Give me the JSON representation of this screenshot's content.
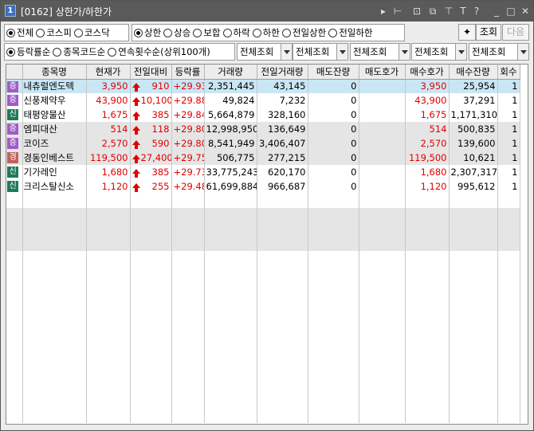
{
  "window": {
    "number": "1",
    "title": "[0162] 상한가/하한가",
    "title_icons": [
      "play-icon",
      "pin-icon",
      "copy-icon",
      "restore-icon",
      "pin2-icon",
      "font-icon",
      "help-icon",
      "minimize-icon",
      "maximize-icon",
      "close-icon"
    ]
  },
  "filters1": {
    "market": [
      {
        "label": "전체",
        "checked": true
      },
      {
        "label": "코스피",
        "checked": false
      },
      {
        "label": "코스닥",
        "checked": false
      }
    ],
    "type": [
      {
        "label": "상한",
        "checked": true
      },
      {
        "label": "상승",
        "checked": false
      },
      {
        "label": "보합",
        "checked": false
      },
      {
        "label": "하락",
        "checked": false
      },
      {
        "label": "하한",
        "checked": false
      },
      {
        "label": "전일상한",
        "checked": false
      },
      {
        "label": "전일하한",
        "checked": false
      }
    ],
    "query_label": "조회",
    "next_label": "다음"
  },
  "filters2": {
    "sort": [
      {
        "label": "등락률순",
        "checked": true
      },
      {
        "label": "종목코드순",
        "checked": false
      },
      {
        "label": "연속횟수순(상위100개)",
        "checked": false
      }
    ],
    "selects": [
      "전체조회",
      "전체조회",
      "전체조회",
      "전체조회",
      "전체조회"
    ]
  },
  "table": {
    "columns": [
      "종목명",
      "현재가",
      "전일대비",
      "등락률",
      "거래량",
      "전일거래량",
      "매도잔량",
      "매도호가",
      "매수호가",
      "매수잔량",
      "회수"
    ],
    "rows": [
      {
        "badge": "증",
        "badge_color": "#a05bc8",
        "name": "내츄럴엔도텍",
        "price": "3,950",
        "change": "910",
        "rate": "+29.93",
        "volume": "2,351,445",
        "prev_volume": "43,145",
        "ask_qty": "0",
        "ask": "",
        "bid": "3,950",
        "bid_qty": "25,954",
        "count": "1",
        "style": "sel"
      },
      {
        "badge": "증",
        "badge_color": "#a05bc8",
        "name": "신풍제약우",
        "price": "43,900",
        "change": "10,100",
        "rate": "+29.88",
        "volume": "49,824",
        "prev_volume": "7,232",
        "ask_qty": "0",
        "ask": "",
        "bid": "43,900",
        "bid_qty": "37,291",
        "count": "1",
        "style": ""
      },
      {
        "badge": "신",
        "badge_color": "#1f7a5a",
        "name": "태평양물산",
        "price": "1,675",
        "change": "385",
        "rate": "+29.84",
        "volume": "5,664,879",
        "prev_volume": "328,160",
        "ask_qty": "0",
        "ask": "",
        "bid": "1,675",
        "bid_qty": "1,171,310",
        "count": "1",
        "style": ""
      },
      {
        "badge": "증",
        "badge_color": "#a05bc8",
        "name": "엠피대산",
        "price": "514",
        "change": "118",
        "rate": "+29.80",
        "volume": "12,998,950",
        "prev_volume": "136,649",
        "ask_qty": "0",
        "ask": "",
        "bid": "514",
        "bid_qty": "500,835",
        "count": "1",
        "style": "gray"
      },
      {
        "badge": "증",
        "badge_color": "#a05bc8",
        "name": "코이즈",
        "price": "2,570",
        "change": "590",
        "rate": "+29.80",
        "volume": "8,541,949",
        "prev_volume": "3,406,407",
        "ask_qty": "0",
        "ask": "",
        "bid": "2,570",
        "bid_qty": "139,600",
        "count": "1",
        "style": "gray"
      },
      {
        "badge": "경",
        "badge_color": "#c0625a",
        "name": "경동인베스트",
        "price": "119,500",
        "change": "27,400",
        "rate": "+29.75",
        "volume": "506,775",
        "prev_volume": "277,215",
        "ask_qty": "0",
        "ask": "",
        "bid": "119,500",
        "bid_qty": "10,621",
        "count": "1",
        "style": "gray"
      },
      {
        "badge": "신",
        "badge_color": "#1f7a5a",
        "name": "기가레인",
        "price": "1,680",
        "change": "385",
        "rate": "+29.73",
        "volume": "33,775,243",
        "prev_volume": "620,170",
        "ask_qty": "0",
        "ask": "",
        "bid": "1,680",
        "bid_qty": "2,307,317",
        "count": "1",
        "style": ""
      },
      {
        "badge": "신",
        "badge_color": "#1f7a5a",
        "name": "크리스탈신소",
        "price": "1,120",
        "change": "255",
        "rate": "+29.48",
        "volume": "61,699,884",
        "prev_volume": "966,687",
        "ask_qty": "0",
        "ask": "",
        "bid": "1,120",
        "bid_qty": "995,612",
        "count": "1",
        "style": ""
      }
    ]
  }
}
